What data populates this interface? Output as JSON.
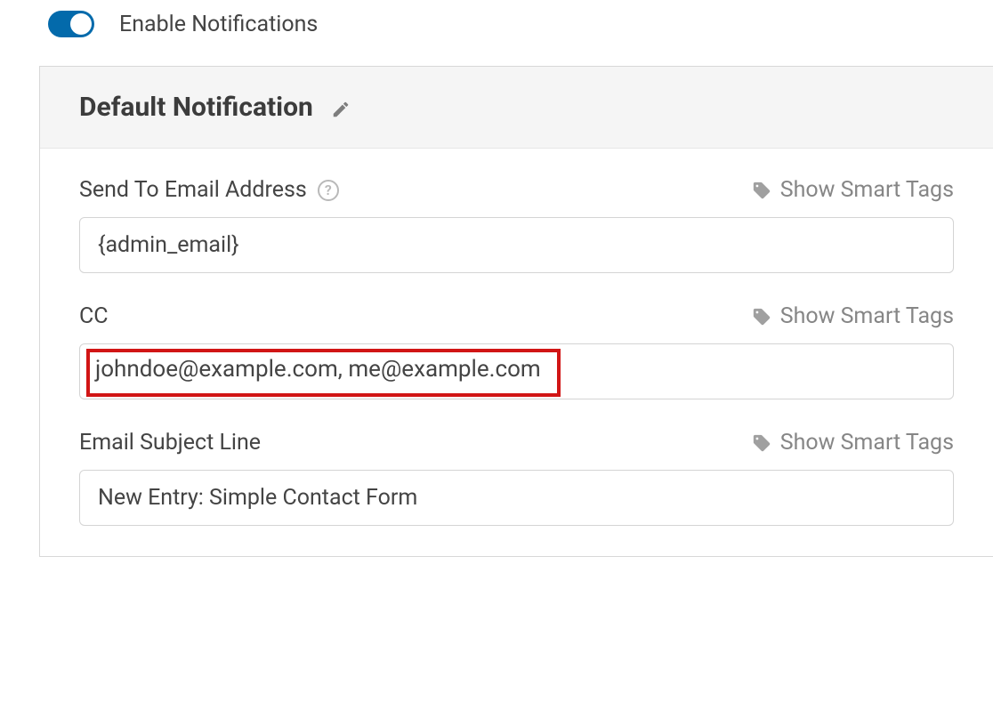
{
  "enable": {
    "label": "Enable Notifications",
    "on": true
  },
  "panel": {
    "title": "Default Notification"
  },
  "fields": {
    "send_to": {
      "label": "Send To Email Address",
      "value": "{admin_email}",
      "smart_tags_label": "Show Smart Tags"
    },
    "cc": {
      "label": "CC",
      "value": "johndoe@example.com, me@example.com",
      "smart_tags_label": "Show Smart Tags"
    },
    "subject": {
      "label": "Email Subject Line",
      "value": "New Entry: Simple Contact Form",
      "smart_tags_label": "Show Smart Tags"
    }
  }
}
